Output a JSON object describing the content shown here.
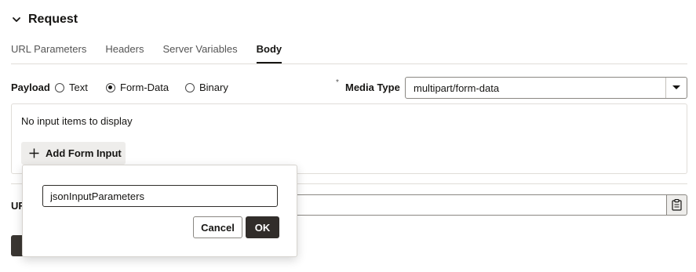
{
  "section": {
    "title": "Request",
    "icon": "chevron-down-icon"
  },
  "tabs": [
    {
      "label": "URL Parameters",
      "active": false
    },
    {
      "label": "Headers",
      "active": false
    },
    {
      "label": "Server Variables",
      "active": false
    },
    {
      "label": "Body",
      "active": true
    }
  ],
  "payload": {
    "label": "Payload",
    "options": [
      {
        "label": "Text",
        "selected": false
      },
      {
        "label": "Form-Data",
        "selected": true
      },
      {
        "label": "Binary",
        "selected": false
      }
    ]
  },
  "media_type": {
    "required_mark": "*",
    "label": "Media Type",
    "value": "multipart/form-data"
  },
  "form_data": {
    "empty_text": "No input items to display",
    "add_label": "Add Form Input"
  },
  "url_row": {
    "label_partial": "UR"
  },
  "popup": {
    "input_value": "jsonInputParameters",
    "cancel_label": "Cancel",
    "ok_label": "OK"
  },
  "colors": {
    "primary_dark": "#312d2a",
    "border": "#8a8782",
    "divider": "#e0ddd8"
  }
}
